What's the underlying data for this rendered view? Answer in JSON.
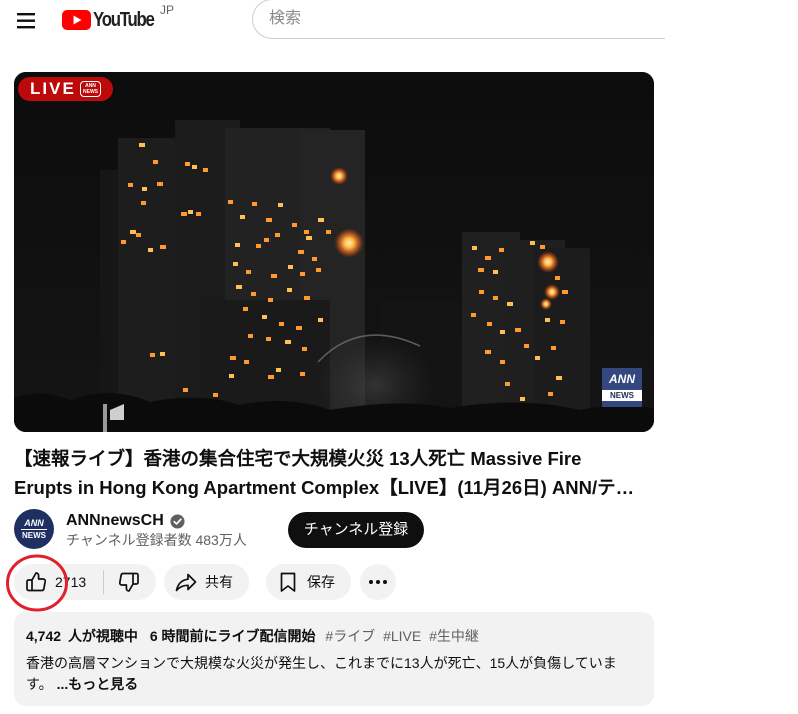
{
  "header": {
    "logo_text": "YouTube",
    "region": "JP",
    "search": {
      "placeholder": "検索",
      "value": ""
    }
  },
  "video": {
    "live_badge": "LIVE",
    "badge_logo": "ANN NEWS",
    "watermark": {
      "top": "ANN",
      "bottom": "NEWS"
    }
  },
  "title": {
    "line1": "【速報ライブ】香港の集合住宅で大規模火災 13人死亡 Massive Fire",
    "line2": "Erupts in Hong Kong Apartment Complex【LIVE】(11月26日) ANN/テ…"
  },
  "channel": {
    "name": "ANNnewsCH",
    "verified": true,
    "subscribers": "チャンネル登録者数 483万人",
    "avatar": {
      "top": "ANN",
      "bottom": "NEWS"
    },
    "subscribe_label": "チャンネル登録"
  },
  "actions": {
    "like_count": "2713",
    "share_label": "共有",
    "save_label": "保存"
  },
  "description": {
    "viewer_count": "4,742",
    "viewer_label": "人が視聴中",
    "stream_started": "6 時間前にライブ配信開始",
    "hashtags": [
      "#ライブ",
      "#LIVE",
      "#生中継"
    ],
    "text": "香港の高層マンションで大規模な火災が発生し、これまでに13人が死亡、15人が負傷しています。",
    "more_label": "...もっと見る"
  },
  "icons": {
    "menu": "menu-icon",
    "logo": "youtube-play-icon",
    "verified": "verified-check-icon",
    "like": "thumbs-up-icon",
    "dislike": "thumbs-down-icon",
    "share": "share-icon",
    "save": "bookmark-icon",
    "more": "more-dots-icon"
  },
  "colors": {
    "brand_red": "#ff0000",
    "live_badge": "#cc0a0a",
    "subscribe_button": "#0f0f0f",
    "pill_background": "#f2f2f2",
    "annotation_circle": "#e0202a",
    "fire": "#ff9930"
  }
}
